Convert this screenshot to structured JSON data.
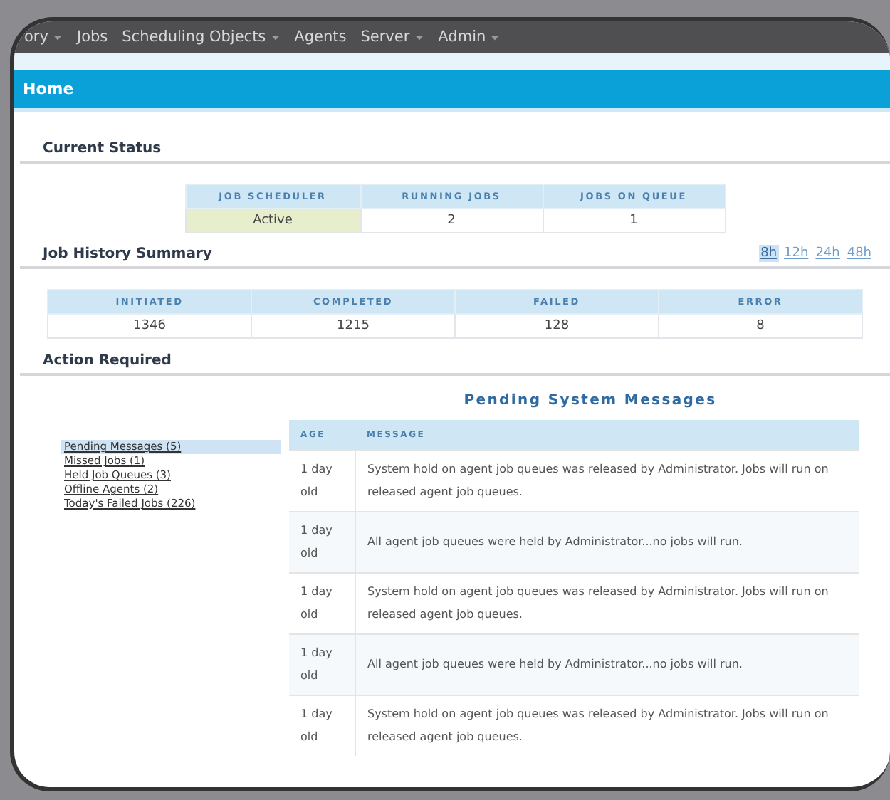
{
  "nav": [
    {
      "label": "ory",
      "menu": true
    },
    {
      "label": "Jobs",
      "menu": false
    },
    {
      "label": "Scheduling Objects",
      "menu": true
    },
    {
      "label": "Agents",
      "menu": false
    },
    {
      "label": "Server",
      "menu": true
    },
    {
      "label": "Admin",
      "menu": true
    }
  ],
  "page_title": "Home",
  "current_status": {
    "title": "Current Status",
    "columns": [
      "JOB SCHEDULER",
      "RUNNING JOBS",
      "JOBS ON QUEUE"
    ],
    "cells": [
      {
        "text": "Active",
        "highlight": true
      },
      {
        "text": "2",
        "highlight": false
      },
      {
        "text": "1",
        "highlight": false
      }
    ]
  },
  "job_history": {
    "title": "Job History Summary",
    "ranges": [
      {
        "label": "8h",
        "selected": true
      },
      {
        "label": "12h",
        "selected": false
      },
      {
        "label": "24h",
        "selected": false
      },
      {
        "label": "48h",
        "selected": false
      }
    ],
    "columns": [
      "INITIATED",
      "COMPLETED",
      "FAILED",
      "ERROR"
    ],
    "cells": [
      "1346",
      "1215",
      "128",
      "8"
    ]
  },
  "action_required": {
    "title": "Action Required",
    "links": [
      {
        "label": "Pending Messages (5)",
        "selected": true
      },
      {
        "label": "Missed Jobs (1)",
        "selected": false
      },
      {
        "label": "Held Job Queues (3)",
        "selected": false
      },
      {
        "label": "Offline Agents (2)",
        "selected": false
      },
      {
        "label": "Today's Failed Jobs (226)",
        "selected": false
      }
    ],
    "messages": {
      "title": "Pending System Messages",
      "columns": [
        "AGE",
        "MESSAGE"
      ],
      "rows": [
        {
          "age": "1 day old",
          "message": "System hold on agent job queues was released by Administrator. Jobs will run on released agent job queues."
        },
        {
          "age": "1 day old",
          "message": "All agent job queues were held by Administrator...no jobs will run."
        },
        {
          "age": "1 day old",
          "message": "System hold on agent job queues was released by Administrator. Jobs will run on released agent job queues."
        },
        {
          "age": "1 day old",
          "message": "All agent job queues were held by Administrator...no jobs will run."
        },
        {
          "age": "1 day old",
          "message": "System hold on agent job queues was released by Administrator. Jobs will run on released agent job queues."
        }
      ]
    }
  }
}
